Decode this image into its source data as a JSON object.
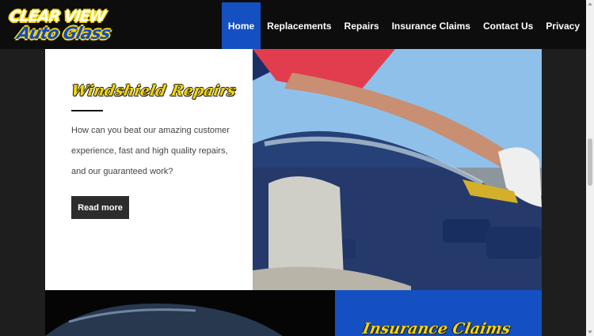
{
  "logo": {
    "line1": "CLEAR VIEW",
    "line2": "Auto Glass"
  },
  "nav": {
    "items": [
      {
        "label": "Home",
        "active": true
      },
      {
        "label": "Replacements"
      },
      {
        "label": "Repairs"
      },
      {
        "label": "Insurance Claims"
      },
      {
        "label": "Contact Us"
      },
      {
        "label": "Privacy"
      }
    ]
  },
  "section_repairs": {
    "title": "Windshield Repairs",
    "description": "How can you beat our amazing customer experience, fast and high quality repairs, and our guaranteed work?",
    "button_label": "Read more"
  },
  "section_insurance": {
    "title": "Insurance Claims"
  },
  "colors": {
    "accent_blue": "#1550c2",
    "brand_yellow": "#f5d60d",
    "header_bg": "#0d0d0d"
  }
}
